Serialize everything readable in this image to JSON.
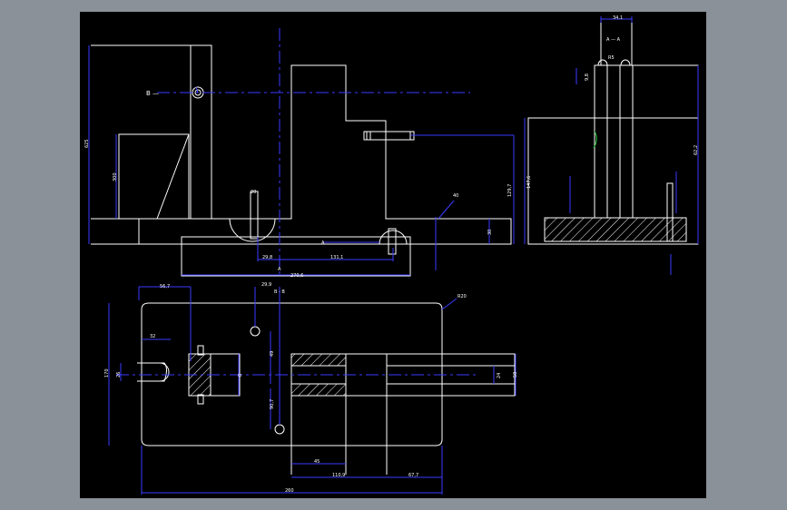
{
  "section_labels": {
    "section_b": "B —",
    "section_aa": "A — A",
    "section_bb": "B - B",
    "mark_a_bottom": "A",
    "mark_a_mid": "A"
  },
  "dimensions": {
    "d_625": "625",
    "d_300": "300",
    "d_20": "20",
    "d_40": "40",
    "d_29_8": "29,8",
    "d_131_1": "131,1",
    "d_270_6": "270,6",
    "d_129_7": "129,7",
    "d_30": "30",
    "d_34_1": "34,1",
    "d_r5": "R5",
    "d_9_8": "9,8",
    "d_147_6": "147,6",
    "d_62_2": "62,2",
    "d_56_7": "56,7",
    "d_29_9": "29,9",
    "d_r20": "R20",
    "d_32": "32",
    "d_170": "170",
    "d_26": "26",
    "d_8": "8",
    "d_49": "49",
    "d_90_7": "90,7",
    "d_24": "24",
    "d_50": "50",
    "d_45": "45",
    "d_110_9": "110,9",
    "d_67_7": "67,7",
    "d_260": "260"
  },
  "colors": {
    "background": "#000000",
    "outer_frame": "#8b9199",
    "geometry": "#ffffff",
    "dimension": "#3a3aff",
    "annotation": "#2ecc40"
  }
}
